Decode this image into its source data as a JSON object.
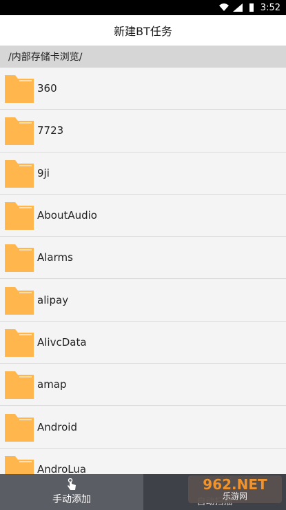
{
  "status_bar": {
    "time": "3:52",
    "icons": [
      "wifi-icon",
      "signal-icon",
      "battery-icon"
    ]
  },
  "title": "新建BT任务",
  "path": "/内部存储卡浏览/",
  "folders": [
    {
      "label": "360"
    },
    {
      "label": "7723"
    },
    {
      "label": "9ji"
    },
    {
      "label": "AboutAudio"
    },
    {
      "label": "Alarms"
    },
    {
      "label": "alipay"
    },
    {
      "label": "AlivcData"
    },
    {
      "label": "amap"
    },
    {
      "label": "Android"
    },
    {
      "label": "AndroLua"
    }
  ],
  "bottom": {
    "manual_label": "手动添加",
    "right_label": "自动扫描",
    "watermark_top": "962.NET",
    "watermark_bottom": "乐游网"
  },
  "colors": {
    "folder": "#ffb74d",
    "path_bar": "#d6d6d6",
    "bottom_left": "#5b5d64",
    "bottom_right": "#3f4148"
  }
}
